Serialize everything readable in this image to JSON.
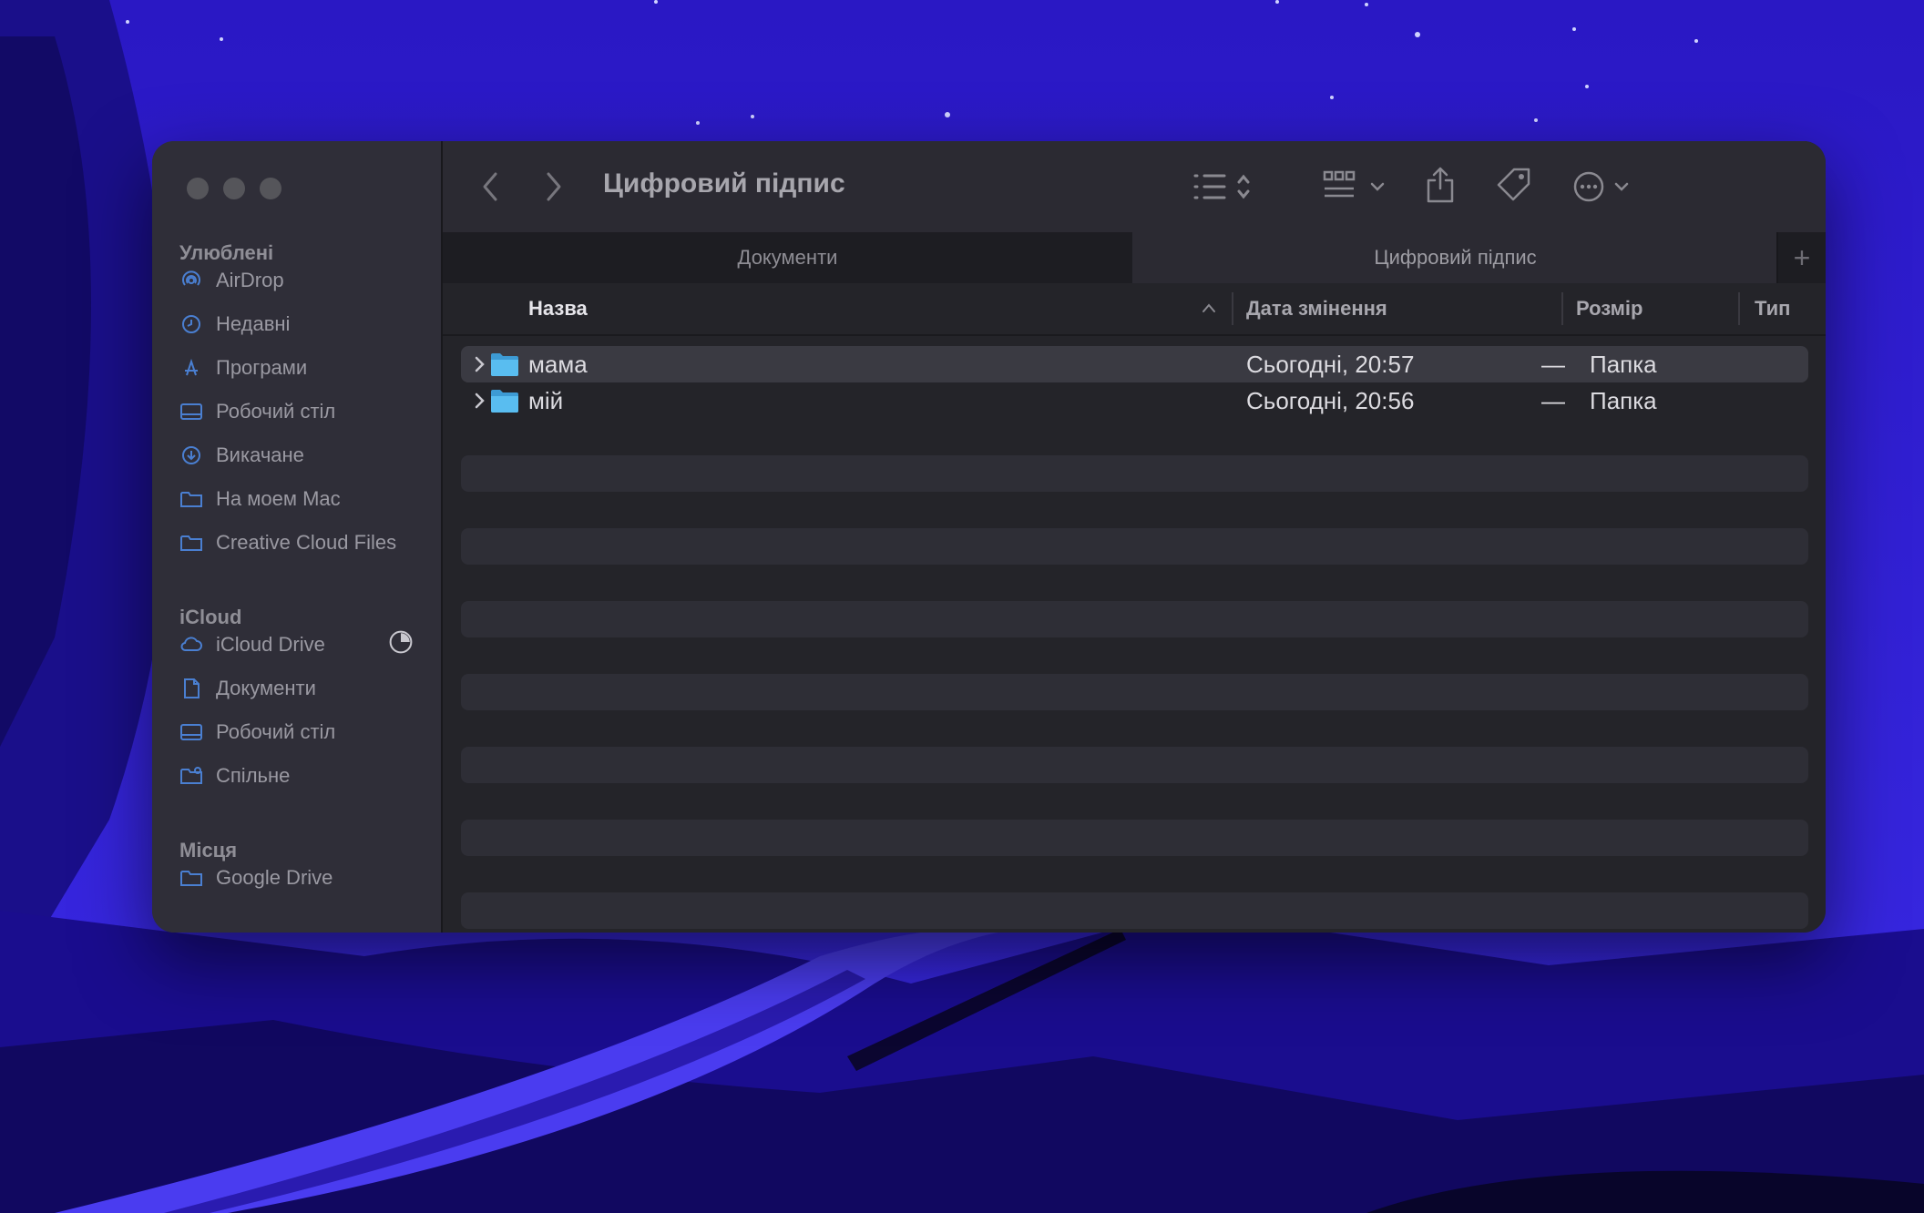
{
  "window": {
    "title": "Цифровий підпис"
  },
  "sidebar": {
    "sections": [
      {
        "title": "Улюблені",
        "items": [
          {
            "label": "AirDrop",
            "icon": "airdrop-icon"
          },
          {
            "label": "Недавні",
            "icon": "clock-icon"
          },
          {
            "label": "Програми",
            "icon": "applications-icon"
          },
          {
            "label": "Робочий стіл",
            "icon": "desktop-icon"
          },
          {
            "label": "Викачане",
            "icon": "download-icon"
          },
          {
            "label": "На моем Mac",
            "icon": "folder-icon"
          },
          {
            "label": "Creative Cloud Files",
            "icon": "folder-icon"
          }
        ]
      },
      {
        "title": "iCloud",
        "items": [
          {
            "label": "iCloud Drive",
            "icon": "cloud-icon",
            "status_icon": "storage-pie-icon"
          },
          {
            "label": "Документи",
            "icon": "document-icon"
          },
          {
            "label": "Робочий стіл",
            "icon": "desktop-icon"
          },
          {
            "label": "Спільне",
            "icon": "shared-folder-icon"
          }
        ]
      },
      {
        "title": "Місця",
        "items": [
          {
            "label": "Google Drive",
            "icon": "folder-icon"
          }
        ]
      }
    ]
  },
  "tabs": [
    {
      "label": "Документи",
      "active": false
    },
    {
      "label": "Цифровий підпис",
      "active": true
    }
  ],
  "columns": {
    "name": "Назва",
    "date": "Дата змінення",
    "size": "Розмір",
    "kind": "Тип"
  },
  "files": [
    {
      "name": "мама",
      "date": "Сьогодні, 20:57",
      "size": "—",
      "kind": "Папка",
      "selected": true
    },
    {
      "name": "мій",
      "date": "Сьогодні, 20:56",
      "size": "—",
      "kind": "Папка",
      "selected": false
    }
  ],
  "colors": {
    "folder": "#4fb3ea",
    "accent": "#2a1bd0"
  }
}
